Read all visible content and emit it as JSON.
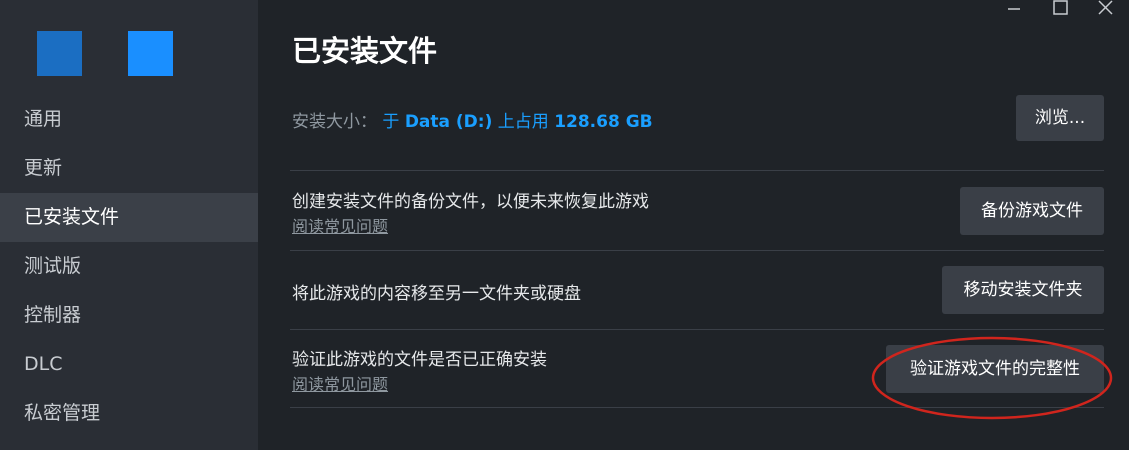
{
  "app": {
    "logo_colors": [
      "#1b6ec2",
      "#1a8fff"
    ]
  },
  "sidebar": {
    "items": [
      {
        "label": "通用",
        "active": false
      },
      {
        "label": "更新",
        "active": false
      },
      {
        "label": "已安装文件",
        "active": true
      },
      {
        "label": "测试版",
        "active": false
      },
      {
        "label": "控制器",
        "active": false
      },
      {
        "label": "DLC",
        "active": false
      },
      {
        "label": "私密管理",
        "active": false
      }
    ]
  },
  "main": {
    "title": "已安装文件",
    "install_size": {
      "label": "安装大小：",
      "location_prefix": "于 ",
      "drive": "Data (D:)",
      "location_mid": " 上占用 ",
      "size": "128.68 GB"
    },
    "browse_button": "浏览...",
    "rows": [
      {
        "text": "创建安装文件的备份文件，以便未来恢复此游戏",
        "link": "阅读常见问题",
        "button": "备份游戏文件"
      },
      {
        "text": "将此游戏的内容移至另一文件夹或硬盘",
        "button": "移动安装文件夹"
      },
      {
        "text": "验证此游戏的文件是否已正确安装",
        "link": "阅读常见问题",
        "button": "验证游戏文件的完整性"
      }
    ]
  },
  "window_controls": {
    "icons": [
      "minimize-icon",
      "maximize-icon",
      "close-icon"
    ]
  },
  "colors": {
    "accent": "#1a9fff",
    "highlight": "#d0251d"
  }
}
